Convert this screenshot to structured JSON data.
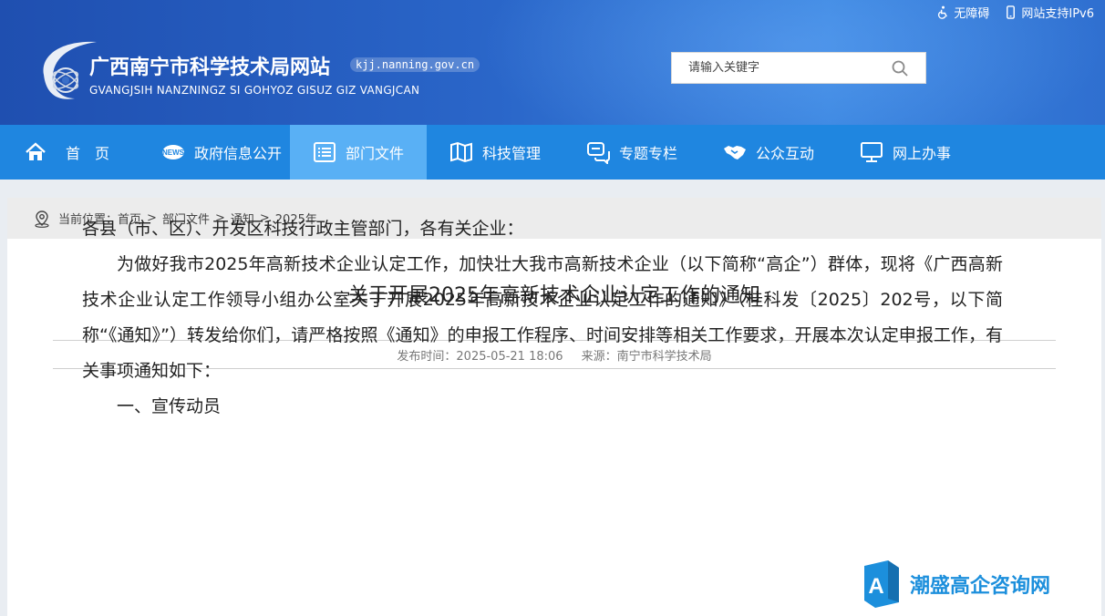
{
  "header": {
    "title": "广西南宁市科学技术局网站",
    "domain": "kjj.nanning.gov.cn",
    "subtitle": "GVANGJSIH NANZNINGZ SI GOHYOZ GISUZ GIZ VANGJCAN",
    "top_links": [
      {
        "label": "无障碍",
        "icon": "accessibility-icon"
      },
      {
        "label": "网站支持IPv6",
        "icon": "mobile-icon"
      }
    ],
    "search": {
      "placeholder": "请输入关键字",
      "value": ""
    }
  },
  "nav": {
    "items": [
      {
        "label": "首页",
        "icon": "home-icon"
      },
      {
        "label": "政府信息公开",
        "icon": "news-icon"
      },
      {
        "label": "部门文件",
        "icon": "document-list-icon",
        "active": true
      },
      {
        "label": "科技管理",
        "icon": "map-icon"
      },
      {
        "label": "专题专栏",
        "icon": "chat-icon"
      },
      {
        "label": "公众互动",
        "icon": "handshake-icon"
      },
      {
        "label": "网上办事",
        "icon": "monitor-icon"
      }
    ]
  },
  "breadcrumb": {
    "prefix": "当前位置：",
    "items": [
      "首页",
      "部门文件",
      "通知",
      "2025年"
    ],
    "separator": ">"
  },
  "article": {
    "title": "关于开展2025年高新技术企业认定工作的通知",
    "publish_label": "发布时间：",
    "publish_time": "2025-05-21 18:06",
    "source_label": "来源：",
    "source": "南宁市科学技术局",
    "paragraphs": [
      "各县（市、区）、开发区科技行政主管部门，各有关企业：",
      "为做好我市2025年高新技术企业认定工作，加快壮大我市高新技术企业（以下简称“高企”）群体，现将《广西高新技术企业认定工作领导小组办公室关于开展2025年高新技术企业认定工作的通知》（桂科发〔2025〕202号，以下简称“《通知》”）转发给你们，请严格按照《通知》的申报工作程序、时间安排等相关工作要求，开展本次认定申报工作，有关事项通知如下：",
      "一、宣传动员"
    ]
  },
  "watermark": {
    "text": "潮盛高企咨询网"
  },
  "colors": {
    "header_blue": "#2a66c9",
    "nav_blue": "#1f86e0",
    "nav_active": "#59b0f5",
    "watermark": "#1c8fdc"
  }
}
